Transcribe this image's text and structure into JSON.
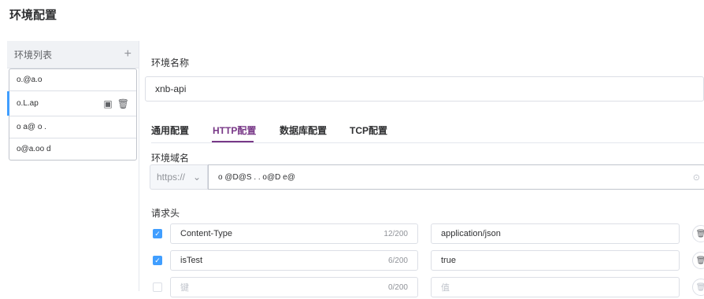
{
  "page": {
    "title": "环境配置"
  },
  "env_list": {
    "label": "环境列表",
    "add_icon": "+",
    "items": [
      {
        "label": "o.@a.o"
      },
      {
        "label": "o.L.ap"
      },
      {
        "label": "o a@ o ."
      },
      {
        "label": "o@a.oo d"
      }
    ],
    "copy_icon": "copy-icon",
    "delete_icon": "trash-icon"
  },
  "form": {
    "name_label": "环境名称",
    "name_value": "xnb-api",
    "tabs": [
      "通用配置",
      "HTTP配置",
      "数据库配置",
      "TCP配置"
    ],
    "active_tab": 1,
    "domain_label": "环境域名",
    "protocol": "https://",
    "domain_value": "o @D@S . . o@D e@",
    "headers_label": "请求头",
    "headers": [
      {
        "checked": true,
        "key": "Content-Type",
        "key_count": "12/200",
        "value": "application/json"
      },
      {
        "checked": true,
        "key": "isTest",
        "key_count": "6/200",
        "value": "true"
      },
      {
        "checked": false,
        "key_placeholder": "键",
        "key_count": "0/200",
        "value_placeholder": "值"
      }
    ]
  },
  "colors": {
    "accent": "#783887",
    "checkbox": "#409eff"
  }
}
